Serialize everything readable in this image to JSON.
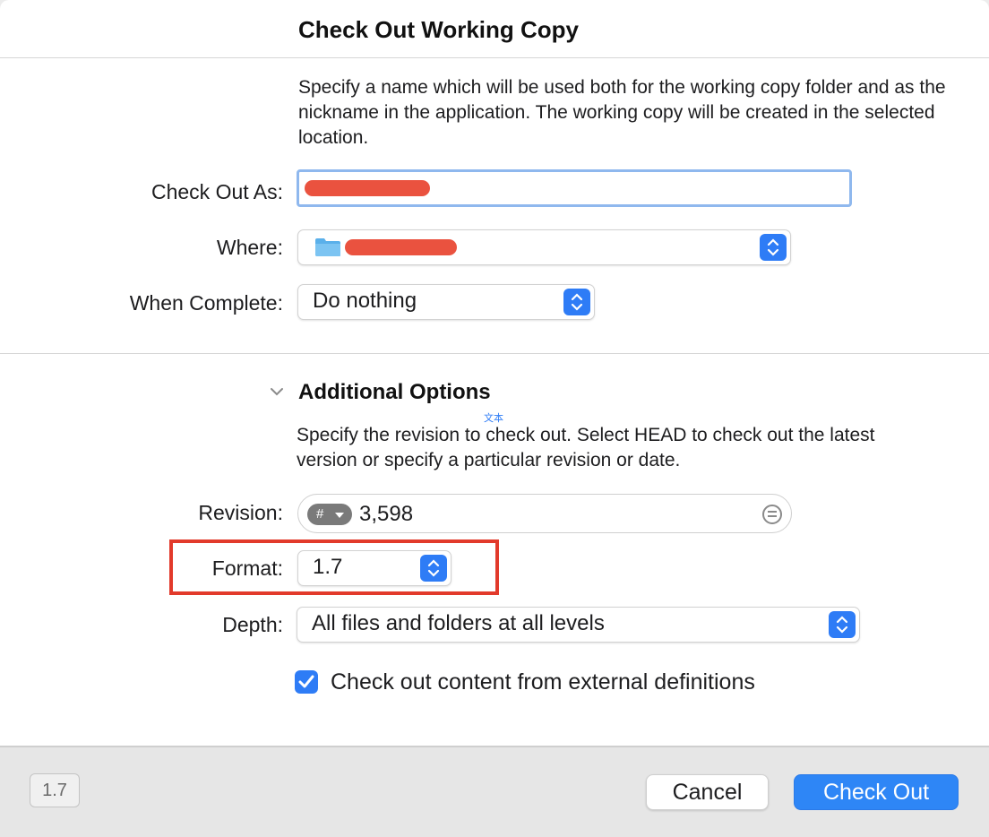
{
  "dialog": {
    "title": "Check Out Working Copy",
    "description": "Specify a name which will be used both for the working copy folder and as the nickname in the application. The working copy will be created in the selected location."
  },
  "form": {
    "check_out_as_label": "Check Out As:",
    "where_label": "Where:",
    "when_complete_label": "When Complete:",
    "when_complete_value": "Do nothing"
  },
  "additional": {
    "title": "Additional Options",
    "ime_hint": "文本",
    "description": "Specify the revision to check out. Select HEAD to check out the latest version or specify a particular revision or date.",
    "revision_label": "Revision:",
    "revision_type_symbol": "#",
    "revision_value": "3,598",
    "format_label": "Format:",
    "format_value": "1.7",
    "depth_label": "Depth:",
    "depth_value": "All files and folders at all levels",
    "external_label": "Check out content from external definitions",
    "external_checked": true
  },
  "footer": {
    "version_badge": "1.7",
    "cancel_label": "Cancel",
    "checkout_label": "Check Out"
  },
  "colors": {
    "accent": "#2e7cf6",
    "highlight_annotation": "#e23a2b",
    "redaction": "#e8432f"
  }
}
